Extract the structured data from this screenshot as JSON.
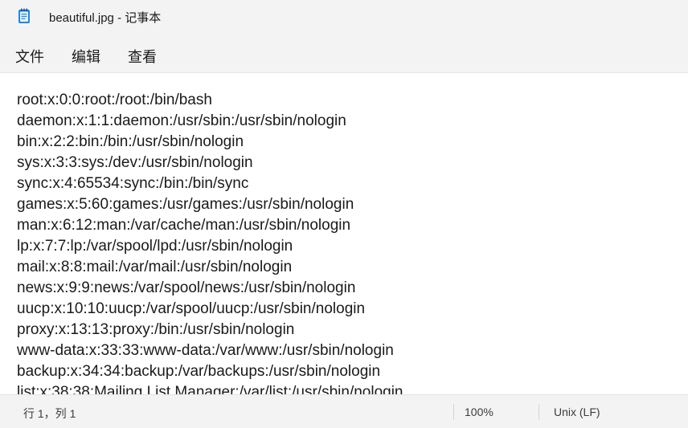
{
  "window": {
    "title": "beautiful.jpg - 记事本",
    "app_icon": "notepad-icon"
  },
  "menu": {
    "file": "文件",
    "edit": "编辑",
    "view": "查看"
  },
  "editor": {
    "lines": [
      "root:x:0:0:root:/root:/bin/bash",
      "daemon:x:1:1:daemon:/usr/sbin:/usr/sbin/nologin",
      "bin:x:2:2:bin:/bin:/usr/sbin/nologin",
      "sys:x:3:3:sys:/dev:/usr/sbin/nologin",
      "sync:x:4:65534:sync:/bin:/bin/sync",
      "games:x:5:60:games:/usr/games:/usr/sbin/nologin",
      "man:x:6:12:man:/var/cache/man:/usr/sbin/nologin",
      "lp:x:7:7:lp:/var/spool/lpd:/usr/sbin/nologin",
      "mail:x:8:8:mail:/var/mail:/usr/sbin/nologin",
      "news:x:9:9:news:/var/spool/news:/usr/sbin/nologin",
      "uucp:x:10:10:uucp:/var/spool/uucp:/usr/sbin/nologin",
      "proxy:x:13:13:proxy:/bin:/usr/sbin/nologin",
      "www-data:x:33:33:www-data:/var/www:/usr/sbin/nologin",
      "backup:x:34:34:backup:/var/backups:/usr/sbin/nologin",
      "list:x:38:38:Mailing List Manager:/var/list:/usr/sbin/nologin"
    ]
  },
  "status": {
    "position": "行 1，列 1",
    "zoom": "100%",
    "line_ending": "Unix (LF)"
  },
  "colors": {
    "chrome": "#f3f3f3",
    "editor_bg": "#ffffff",
    "text": "#1a1a1a",
    "icon_accent": "#1e88e5"
  }
}
